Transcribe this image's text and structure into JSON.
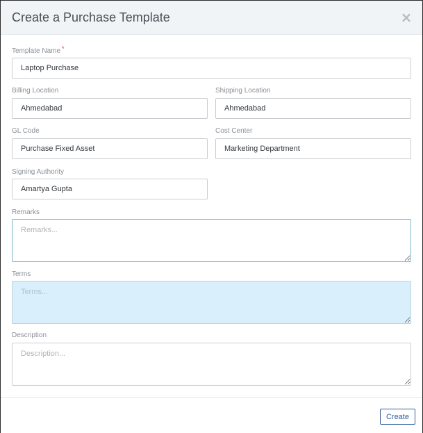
{
  "modal": {
    "title": "Create a Purchase Template",
    "close_symbol": "×"
  },
  "fields": {
    "template_name": {
      "label": "Template Name",
      "required_mark": "*",
      "value": "Laptop Purchase"
    },
    "billing_location": {
      "label": "Billing Location",
      "value": "Ahmedabad"
    },
    "shipping_location": {
      "label": "Shipping Location",
      "value": "Ahmedabad"
    },
    "gl_code": {
      "label": "GL Code",
      "value": "Purchase Fixed Asset"
    },
    "cost_center": {
      "label": "Cost Center",
      "value": "Marketing Department"
    },
    "signing_authority": {
      "label": "Signing Authority",
      "value": "Amartya Gupta"
    },
    "remarks": {
      "label": "Remarks",
      "placeholder": "Remarks..."
    },
    "terms": {
      "label": "Terms",
      "placeholder": "Terms..."
    },
    "description": {
      "label": "Description",
      "placeholder": "Description..."
    }
  },
  "footer": {
    "create_label": "Create"
  },
  "icons": {
    "close": "close-icon"
  },
  "colors": {
    "header_bg": "#f1f4f7",
    "required": "#d9342b",
    "highlight_bg": "#d9f0fc",
    "accent": "#2d5e9e"
  }
}
